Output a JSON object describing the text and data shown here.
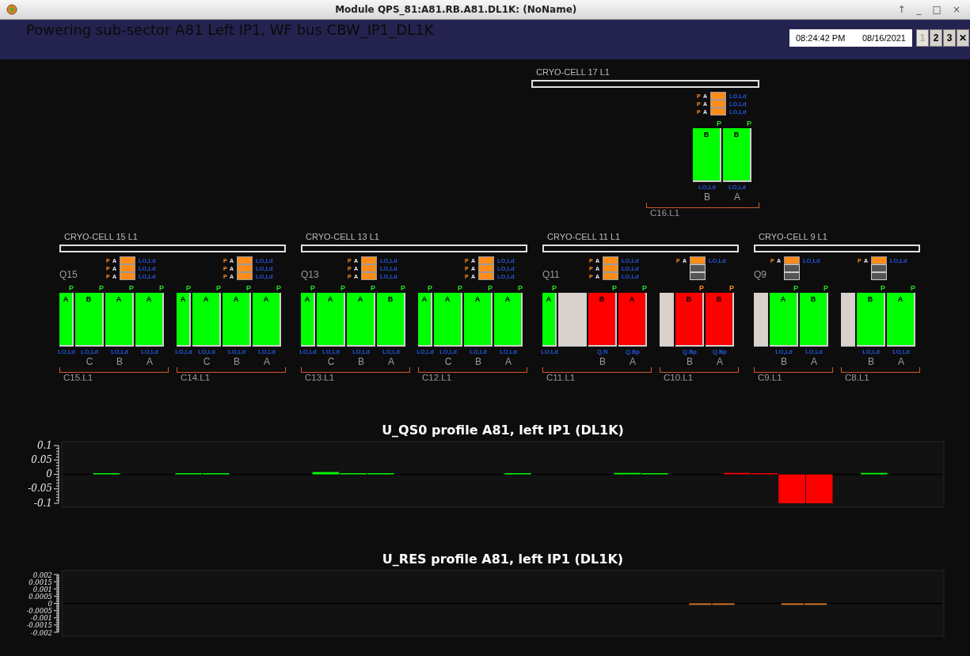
{
  "window": {
    "title": "Module QPS_81:A81.RB.A81.DL1K: (NoName)",
    "controls": [
      "↑",
      "_",
      "□",
      "×"
    ]
  },
  "header": {
    "title": "Powering sub-sector A81 Left IP1, WF bus CBW_IP1_DL1K",
    "time": "08:24:42 PM",
    "date": "08/16/2021",
    "pages": [
      {
        "label": "1",
        "selected": true
      },
      {
        "label": "2",
        "selected": false
      },
      {
        "label": "3",
        "selected": false
      }
    ],
    "close": "✕"
  },
  "rows": [
    {
      "cells": [
        {
          "name": "CRYO-CELL 17 L1",
          "halves": [
            {
              "name": "C16.L1",
              "indicators": [
                {
                  "p": "P",
                  "a": "A",
                  "on": true,
                  "label": "LO,Ld"
                },
                {
                  "p": "P",
                  "a": "A",
                  "on": true,
                  "label": "LO,Ld"
                },
                {
                  "p": "P",
                  "a": "A",
                  "on": true,
                  "label": "LO,Ld"
                }
              ],
              "magnets": [
                {
                  "kind": "wide",
                  "color": "#00ff00",
                  "top": "P",
                  "top_alert": false,
                  "letter": "B",
                  "bottom": "LO,Ld",
                  "pos": "B"
                },
                {
                  "kind": "wide",
                  "color": "#00ff00",
                  "top": "P",
                  "top_alert": false,
                  "letter": "B",
                  "bottom": "LO,Ld",
                  "pos": "A"
                }
              ]
            }
          ]
        }
      ]
    },
    {
      "cells": [
        {
          "name": "CRYO-CELL 15 L1",
          "quad": "Q15",
          "halves": [
            {
              "name": "C15.L1",
              "indicators": [
                {
                  "p": "P",
                  "a": "A",
                  "on": true,
                  "label": "LO,Ld"
                },
                {
                  "p": "P",
                  "a": "A",
                  "on": true,
                  "label": "LO,Ld"
                },
                {
                  "p": "P",
                  "a": "A",
                  "on": true,
                  "label": "LO,Ld"
                }
              ],
              "magnets": [
                {
                  "kind": "narrow",
                  "color": "#00ff00",
                  "top": "P",
                  "top_alert": false,
                  "letter": "A",
                  "bottom": "LO,Ld"
                },
                {
                  "kind": "wide",
                  "color": "#00ff00",
                  "top": "P",
                  "top_alert": false,
                  "letter": "B",
                  "bottom": "LO,Ld",
                  "pos": "C"
                },
                {
                  "kind": "wide",
                  "color": "#00ff00",
                  "top": "P",
                  "top_alert": false,
                  "letter": "A",
                  "bottom": "LO,Ld",
                  "pos": "B"
                },
                {
                  "kind": "wide",
                  "color": "#00ff00",
                  "top": "P",
                  "top_alert": false,
                  "letter": "A",
                  "bottom": "LO,Ld",
                  "pos": "A"
                }
              ]
            },
            {
              "name": "C14.L1",
              "indicators": [
                {
                  "p": "P",
                  "a": "A",
                  "on": true,
                  "label": "LO,Ld"
                },
                {
                  "p": "P",
                  "a": "A",
                  "on": true,
                  "label": "LO,Ld"
                },
                {
                  "p": "P",
                  "a": "A",
                  "on": true,
                  "label": "LO,Ld"
                }
              ],
              "magnets": [
                {
                  "kind": "narrow",
                  "color": "#00ff00",
                  "top": "P",
                  "top_alert": false,
                  "letter": "A",
                  "bottom": "LO,Ld"
                },
                {
                  "kind": "wide",
                  "color": "#00ff00",
                  "top": "P",
                  "top_alert": false,
                  "letter": "A",
                  "bottom": "LO,Ld",
                  "pos": "C"
                },
                {
                  "kind": "wide",
                  "color": "#00ff00",
                  "top": "P",
                  "top_alert": false,
                  "letter": "A",
                  "bottom": "LO,Ld",
                  "pos": "B"
                },
                {
                  "kind": "wide",
                  "color": "#00ff00",
                  "top": "P",
                  "top_alert": false,
                  "letter": "A",
                  "bottom": "LO,Ld",
                  "pos": "A"
                }
              ]
            }
          ]
        },
        {
          "name": "CRYO-CELL 13 L1",
          "quad": "Q13",
          "halves": [
            {
              "name": "C13.L1",
              "indicators": [
                {
                  "p": "P",
                  "a": "A",
                  "on": true,
                  "label": "LO,Ld"
                },
                {
                  "p": "P",
                  "a": "A",
                  "on": true,
                  "label": "LO,Ld"
                },
                {
                  "p": "P",
                  "a": "A",
                  "on": true,
                  "label": "LO,Ld"
                }
              ],
              "magnets": [
                {
                  "kind": "narrow",
                  "color": "#00ff00",
                  "top": "P",
                  "top_alert": false,
                  "letter": "A",
                  "bottom": "LO,Ld"
                },
                {
                  "kind": "wide",
                  "color": "#00ff00",
                  "top": "P",
                  "top_alert": false,
                  "letter": "A",
                  "bottom": "LO,Ld",
                  "pos": "C"
                },
                {
                  "kind": "wide",
                  "color": "#00ff00",
                  "top": "P",
                  "top_alert": false,
                  "letter": "A",
                  "bottom": "LO,Ld",
                  "pos": "B"
                },
                {
                  "kind": "wide",
                  "color": "#00ff00",
                  "top": "P",
                  "top_alert": false,
                  "letter": "B",
                  "bottom": "LO,Ld",
                  "pos": "A"
                }
              ]
            },
            {
              "name": "C12.L1",
              "indicators": [
                {
                  "p": "P",
                  "a": "A",
                  "on": true,
                  "label": "LO,Ld"
                },
                {
                  "p": "P",
                  "a": "A",
                  "on": true,
                  "label": "LO,Ld"
                },
                {
                  "p": "P",
                  "a": "A",
                  "on": true,
                  "label": "LO,Ld"
                }
              ],
              "magnets": [
                {
                  "kind": "narrow",
                  "color": "#00ff00",
                  "top": "P",
                  "top_alert": false,
                  "letter": "A",
                  "bottom": "LO,Ld"
                },
                {
                  "kind": "wide",
                  "color": "#00ff00",
                  "top": "P",
                  "top_alert": false,
                  "letter": "A",
                  "bottom": "LO,Ld",
                  "pos": "C"
                },
                {
                  "kind": "wide",
                  "color": "#00ff00",
                  "top": "P",
                  "top_alert": false,
                  "letter": "A",
                  "bottom": "LO,Ld",
                  "pos": "B"
                },
                {
                  "kind": "wide",
                  "color": "#00ff00",
                  "top": "P",
                  "top_alert": false,
                  "letter": "A",
                  "bottom": "LO,Ld",
                  "pos": "A"
                }
              ]
            }
          ]
        },
        {
          "name": "CRYO-CELL 11 L1",
          "quad": "Q11",
          "halves": [
            {
              "name": "C11.L1",
              "indicators": [
                {
                  "p": "P",
                  "a": "A",
                  "on": true,
                  "label": "LO,Ld"
                },
                {
                  "p": "P",
                  "a": "A",
                  "on": true,
                  "label": "LO,Ld"
                },
                {
                  "p": "P",
                  "a": "A",
                  "on": true,
                  "label": "LO,Ld"
                }
              ],
              "magnets": [
                {
                  "kind": "narrow",
                  "color": "#00ff00",
                  "top": "P",
                  "top_alert": false,
                  "letter": "A",
                  "bottom": "LO,Ld"
                },
                {
                  "kind": "wide",
                  "color": "#d9d2cc"
                },
                {
                  "kind": "wide",
                  "color": "#ff0000",
                  "top": "P",
                  "top_alert": false,
                  "letter": "B",
                  "bottom": "Q.N",
                  "pos": "B"
                },
                {
                  "kind": "wide",
                  "color": "#ff0000",
                  "top": "P",
                  "top_alert": false,
                  "letter": "A",
                  "bottom": "Q.Bp",
                  "pos": "A"
                }
              ]
            },
            {
              "name": "C10.L1",
              "indicators": [
                {
                  "p": "P",
                  "a": "A",
                  "on": true,
                  "label": "LO,Ld"
                },
                {
                  "on": false
                },
                {
                  "on": false
                }
              ],
              "magnets": [
                {
                  "kind": "narrow",
                  "color": "#d9d2cc"
                },
                {
                  "kind": "wide",
                  "color": "#ff0000",
                  "top": "P",
                  "top_alert": true,
                  "letter": "B",
                  "bottom": "Q.Bp",
                  "pos": "B"
                },
                {
                  "kind": "wide",
                  "color": "#ff0000",
                  "top": "P",
                  "top_alert": true,
                  "letter": "B",
                  "bottom": "Q.Bp",
                  "pos": "A"
                }
              ]
            }
          ]
        },
        {
          "name": "CRYO-CELL 9 L1",
          "quad": "Q9",
          "halves": [
            {
              "name": "C9.L1",
              "indicators": [
                {
                  "p": "P",
                  "a": "A",
                  "on": true,
                  "label": "LO,Ld"
                },
                {
                  "on": false
                },
                {
                  "on": false
                }
              ],
              "magnets": [
                {
                  "kind": "narrow",
                  "color": "#d9d2cc"
                },
                {
                  "kind": "wide",
                  "color": "#00ff00",
                  "top": "P",
                  "top_alert": false,
                  "letter": "A",
                  "bottom": "LO,Ld",
                  "pos": "B"
                },
                {
                  "kind": "wide",
                  "color": "#00ff00",
                  "top": "P",
                  "top_alert": false,
                  "letter": "B",
                  "bottom": "LO,Ld",
                  "pos": "A"
                }
              ]
            },
            {
              "name": "C8.L1",
              "indicators": [
                {
                  "p": "P",
                  "a": "A",
                  "on": true,
                  "label": "LO,Ld"
                },
                {
                  "on": false
                },
                {
                  "on": false
                }
              ],
              "magnets": [
                {
                  "kind": "narrow",
                  "color": "#d9d2cc"
                },
                {
                  "kind": "wide",
                  "color": "#00ff00",
                  "top": "P",
                  "top_alert": false,
                  "letter": "B",
                  "bottom": "LO,Ld",
                  "pos": "B"
                },
                {
                  "kind": "wide",
                  "color": "#00ff00",
                  "top": "P",
                  "top_alert": false,
                  "letter": "A",
                  "bottom": "LO,Ld",
                  "pos": "A"
                }
              ]
            }
          ]
        }
      ]
    }
  ],
  "charts": [
    {
      "chart_data": {
        "type": "bar",
        "title": "U_QS0 profile A81, left IP1 (DL1K)",
        "ylim": [
          -0.1,
          0.1
        ],
        "yticks": [
          0.1,
          0.05,
          0,
          -0.05,
          -0.1
        ],
        "series": [
          {
            "color": "#00ff00",
            "values": [
              null,
              0.003,
              null,
              null,
              0.003,
              0.003,
              null,
              null,
              null,
              0.008,
              0.003,
              0.003,
              null,
              null,
              null,
              null,
              0.003,
              null,
              null,
              null,
              0.005,
              0.003,
              null,
              null,
              null,
              null,
              null,
              null,
              null,
              0.005,
              null,
              null
            ]
          },
          {
            "color": "#ff0000",
            "values": [
              null,
              null,
              null,
              null,
              null,
              null,
              null,
              null,
              null,
              null,
              null,
              null,
              null,
              null,
              null,
              null,
              null,
              null,
              null,
              null,
              null,
              null,
              null,
              null,
              0.005,
              0.002,
              -0.1,
              -0.1,
              null,
              null,
              null,
              null
            ]
          }
        ]
      }
    },
    {
      "chart_data": {
        "type": "bar",
        "title": "U_RES profile A81, left IP1 (DL1K)",
        "ylim": [
          -0.002,
          0.002
        ],
        "yticks": [
          0.002,
          0.0015,
          0.001,
          0.0005,
          0,
          -0.0005,
          -0.001,
          -0.0015,
          -0.002
        ],
        "series": [
          {
            "color": "#e07b28",
            "values": [
              null,
              null,
              null,
              null,
              null,
              null,
              null,
              null,
              null,
              null,
              null,
              null,
              null,
              null,
              null,
              null,
              null,
              null,
              null,
              null,
              null,
              null,
              null,
              null,
              null,
              null,
              null,
              -0.0001,
              -0.0001,
              null,
              null,
              -0.0001,
              -0.0001,
              null,
              null,
              null,
              null,
              null
            ]
          }
        ]
      }
    }
  ]
}
